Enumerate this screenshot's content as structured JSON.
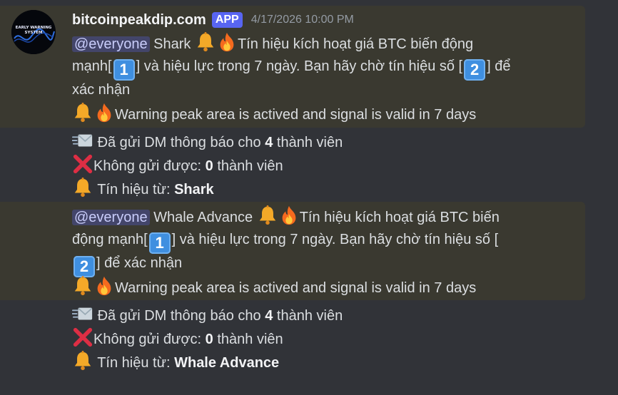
{
  "message": {
    "author": "bitcoinpeakdip.com",
    "badge": "APP",
    "timestamp": "4/17/2026 10:00 PM",
    "avatar_text": "EARLY WARNING SYSTEM",
    "colors": {
      "background": "#313338",
      "highlight": "#3a3930",
      "badge": "#5865f2",
      "mention_text": "#c9cdfb"
    }
  },
  "blocks": [
    {
      "mention": "@everyone",
      "signal_name": "Shark",
      "vi_line1_pre": "Tín hiệu kích hoạt giá BTC biến động",
      "vi_line2_pre": "mạnh[",
      "key1": "1",
      "vi_line2_mid": "] và hiệu lực trong 7 ngày. Bạn hãy chờ tín hiệu số [",
      "key2": "2",
      "vi_line2_post": "] để",
      "vi_line3": "xác nhận",
      "warning_en": "Warning peak area is actived and signal is valid in 7 days",
      "dm_sent_label": "Đã gửi DM thông báo cho",
      "dm_sent_count": "4",
      "dm_sent_suffix": "thành viên",
      "dm_fail_label": "Không gửi được:",
      "dm_fail_count": "0",
      "dm_fail_suffix": "thành viên",
      "signal_from_label": "Tín hiệu từ:",
      "signal_from_value": "Shark"
    },
    {
      "mention": "@everyone",
      "signal_name": "Whale Advance",
      "vi_line1_pre": "Tín hiệu kích hoạt giá BTC biến",
      "vi_line2_pre": "động mạnh[",
      "key1": "1",
      "vi_line2_mid": "] và hiệu lực trong 7 ngày. Bạn hãy chờ tín hiệu số [",
      "key2": "2",
      "vi_line3": "] để xác nhận",
      "warning_en": "Warning peak area is actived and signal is valid in 7 days",
      "dm_sent_label": "Đã gửi DM thông báo cho",
      "dm_sent_count": "4",
      "dm_sent_suffix": "thành viên",
      "dm_fail_label": "Không gửi được:",
      "dm_fail_count": "0",
      "dm_fail_suffix": "thành viên",
      "signal_from_label": "Tín hiệu từ:",
      "signal_from_value": "Whale Advance"
    }
  ]
}
